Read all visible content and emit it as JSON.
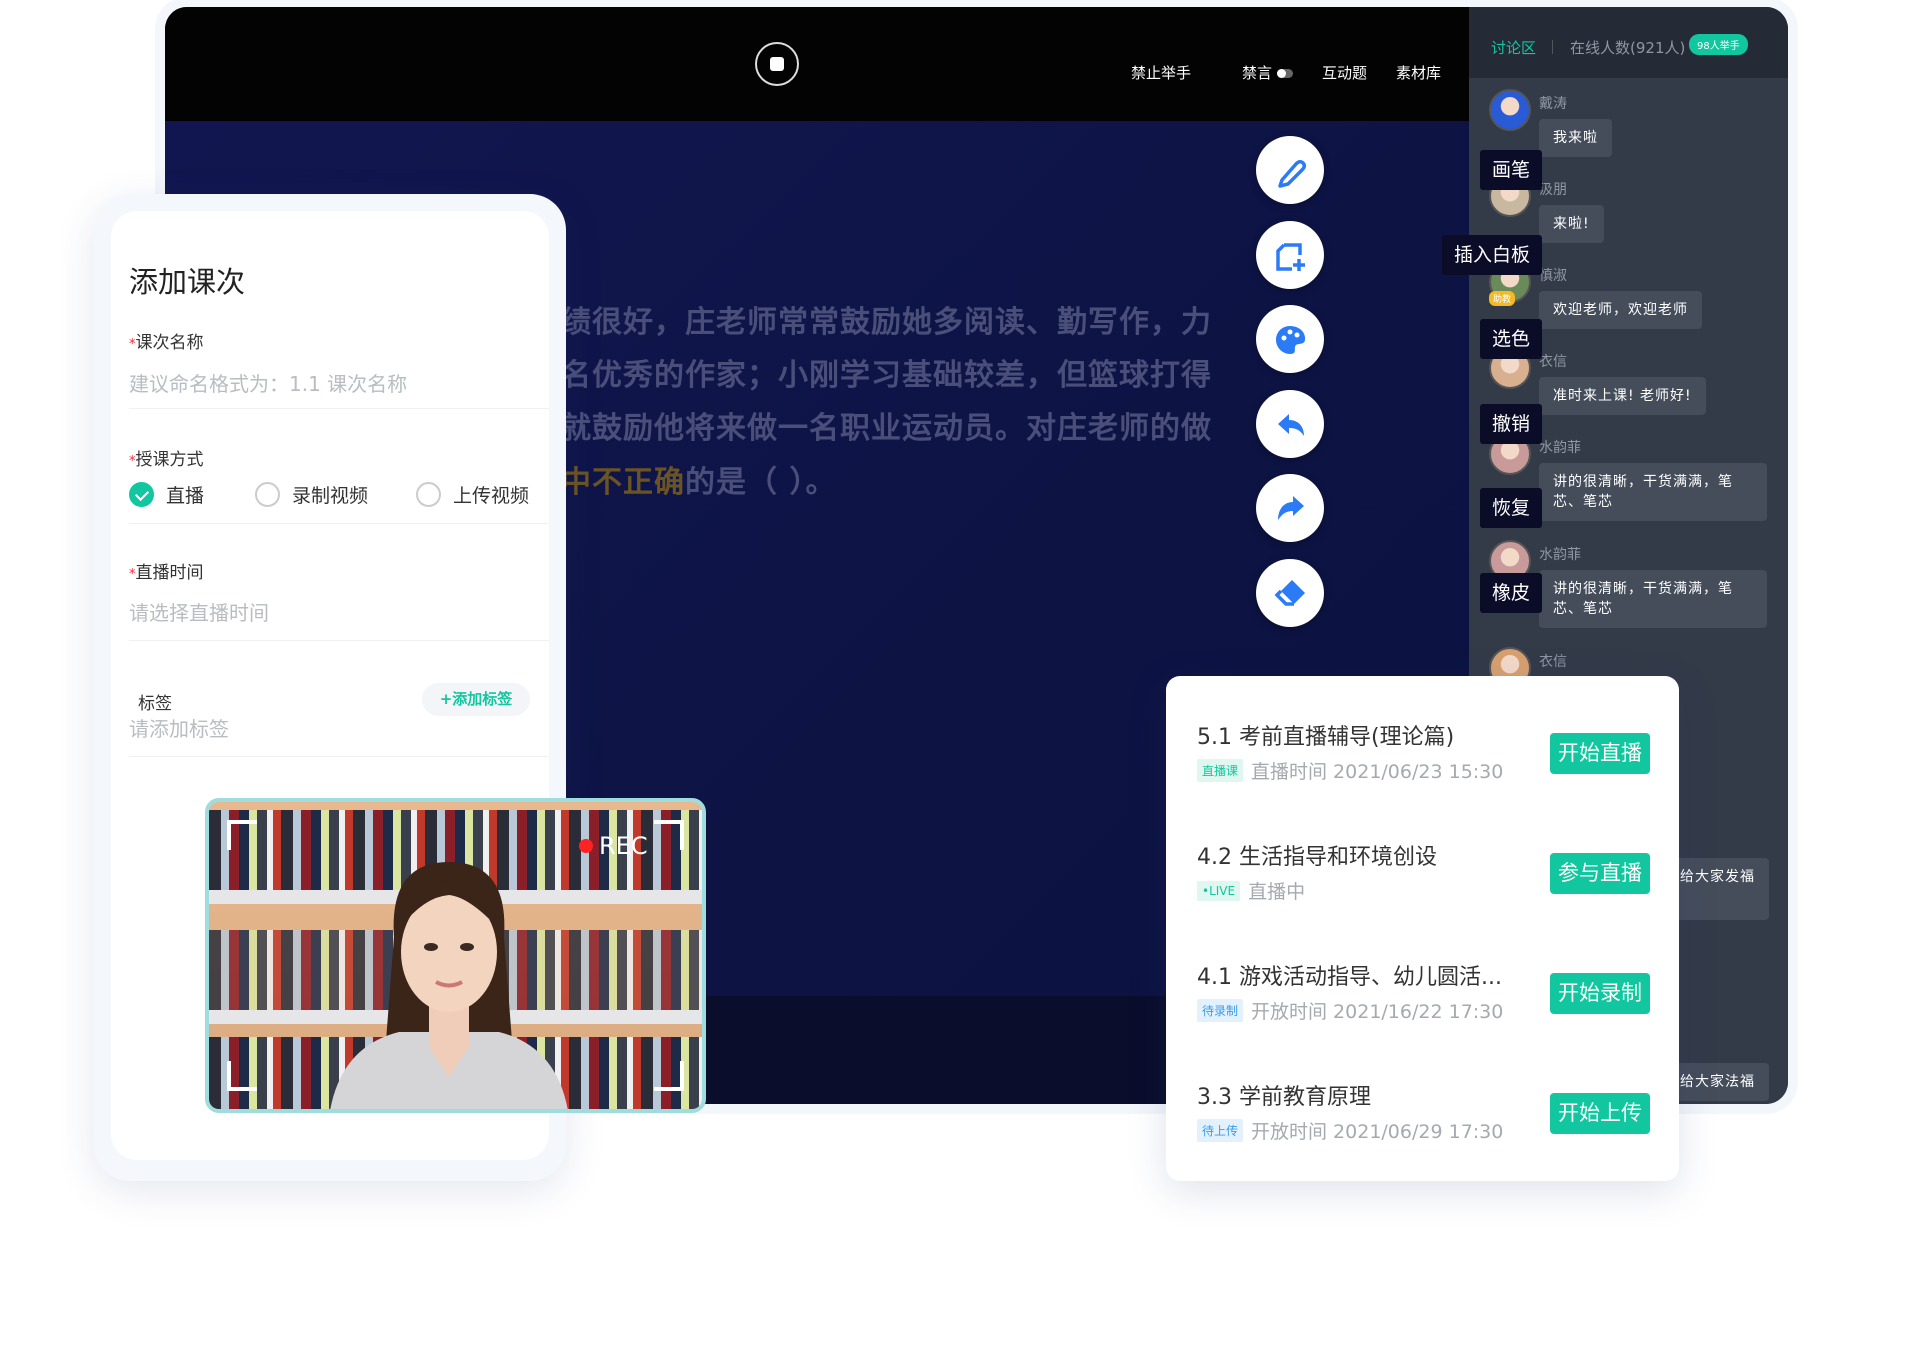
{
  "toolbar": {
    "items": [
      "禁止举手",
      "禁言",
      "互动题",
      "素材库"
    ]
  },
  "slide": {
    "lines": [
      "绩很好，庄老师常常鼓励她多阅读、勤写作，力",
      "名优秀的作家；小刚学习基础较差，但篮球打得",
      "就鼓励他将来做一名职业运动员。对庄老师的做"
    ],
    "last_highlight": "中不正确",
    "last_rest": "的是（ ）。"
  },
  "tools": [
    {
      "label": "画笔",
      "icon": "brush-icon"
    },
    {
      "label": "插入白板",
      "icon": "insert-whiteboard-icon"
    },
    {
      "label": "选色",
      "icon": "palette-icon"
    },
    {
      "label": "撤销",
      "icon": "undo-icon"
    },
    {
      "label": "恢复",
      "icon": "redo-icon"
    },
    {
      "label": "橡皮",
      "icon": "eraser-icon"
    }
  ],
  "chat": {
    "tab": "讨论区",
    "online": "在线人数(921人)",
    "hands": "98人举手",
    "assistant_badge": "助教",
    "messages": [
      {
        "name": "戴涛",
        "text": "我来啦"
      },
      {
        "name": "汲朋",
        "text": "来啦!"
      },
      {
        "name": "慎淑",
        "text": "欢迎老师，欢迎老师"
      },
      {
        "name": "衣信",
        "text": "准时来上课! 老师好!"
      },
      {
        "name": "水韵菲",
        "text": "讲的很清晰，干货满满，笔芯、笔芯"
      },
      {
        "name": "水韵菲",
        "text": "讲的很清晰，干货满满，笔芯、笔芯"
      },
      {
        "name": "衣信",
        "text": ""
      }
    ],
    "partial": [
      "好!",
      "师",
      "给大家发福",
      "好!",
      "给大家法福"
    ]
  },
  "form": {
    "title": "添加课次",
    "name_label": "课次名称",
    "name_placeholder": "建议命名格式为：1.1 课次名称",
    "mode_label": "授课方式",
    "modes": [
      "直播",
      "录制视频",
      "上传视频"
    ],
    "selected_mode": "直播",
    "time_label": "直播时间",
    "time_placeholder": "请选择直播时间",
    "tag_label": "标签",
    "add_tag": "添加标签",
    "tag_placeholder": "请添加标签",
    "required": "*"
  },
  "camera": {
    "rec": "REC"
  },
  "courses": [
    {
      "title": "5.1 考前直播辅导(理论篇)",
      "tag": "直播课",
      "info": "直播时间 2021/06/23 15:30",
      "button": "开始直播"
    },
    {
      "title": "4.2 生活指导和环境创设",
      "tag": "•LIVE",
      "info": "直播中",
      "button": "参与直播"
    },
    {
      "title": "4.1 游戏活动指导、幼儿圆活...",
      "tag": "待录制",
      "info": "开放时间 2021/16/22 17:30",
      "button": "开始录制"
    },
    {
      "title": "3.3 学前教育原理",
      "tag": "待上传",
      "info": "开放时间 2021/06/29 17:30",
      "button": "开始上传"
    }
  ],
  "colors": {
    "accent": "#12c79f",
    "slide_bg": "#0e1340",
    "chat_bg": "#333a48",
    "tool_icon": "#2b7bf6"
  }
}
